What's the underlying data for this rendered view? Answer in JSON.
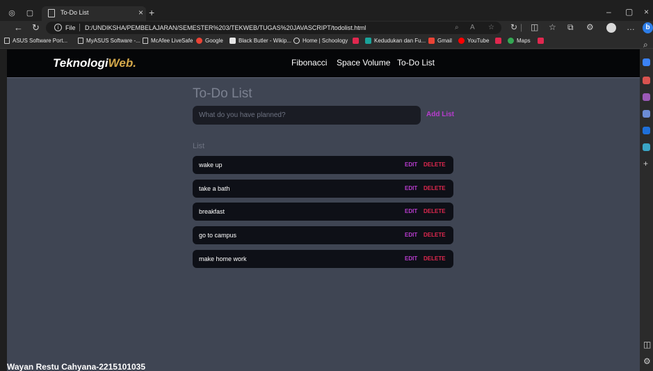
{
  "browser": {
    "tab_title": "To-Do List",
    "url_scheme": "File",
    "url": "D:/UNDIKSHA/PEMBELAJARAN/SEMESTER%203/TEKWEB/TUGAS%20JAVASCRIPT/todolist.html",
    "bookmarks": [
      "ASUS Software Port...",
      "MyASUS Software -...",
      "McAfee LiveSafe",
      "Google",
      "Black Butler - Wikip...",
      "Home | Schoology",
      "",
      "Kedudukan dan Fu...",
      "Gmail",
      "YouTube",
      "",
      "Maps",
      ""
    ]
  },
  "site": {
    "brand_main": "Teknologi",
    "brand_accent": "Web.",
    "nav": [
      "Fibonacci",
      "Space Volume",
      "To-Do List"
    ]
  },
  "todo": {
    "title": "To-Do List",
    "input_placeholder": "What do you have planned?",
    "add_label": "Add List",
    "list_label": "List",
    "edit_label": "EDIT",
    "delete_label": "DELETE",
    "items": [
      "wake up",
      "take a bath",
      "breakfast",
      "go to campus",
      "make home work"
    ]
  },
  "footer": {
    "author": "Wayan Restu Cahyana-2215101035"
  },
  "colors": {
    "page_bg": "#3f4553",
    "nav_bg": "#050608",
    "accent_purple": "#b83ccf",
    "delete_red": "#e0284f",
    "brand_gold": "#d4a84a"
  }
}
